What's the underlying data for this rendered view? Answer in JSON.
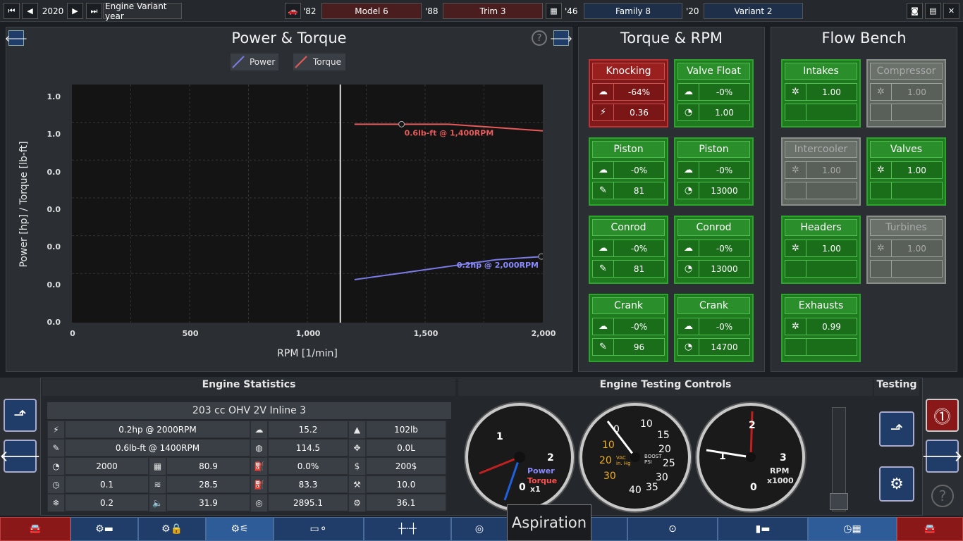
{
  "topbar": {
    "year_value": "2020",
    "year_label": "Engine Variant year",
    "model_year": "'82",
    "model": "Model 6",
    "trim_year": "'88",
    "trim": "Trim 3",
    "family_year": "'46",
    "family": "Family 8",
    "variant_year": "'20",
    "variant": "Variant 2"
  },
  "chart_panel": {
    "title": "Power & Torque",
    "legend_power": "Power",
    "legend_torque": "Torque"
  },
  "chart_data": {
    "type": "line",
    "xlabel": "RPM [1/min]",
    "ylabel": "Power [hp] / Torque [lb-ft]",
    "x_ticks": [
      "0",
      "500",
      "1,000",
      "1,500",
      "2,000"
    ],
    "y_ticks": [
      "1.0",
      "1.0",
      "0.0",
      "0.0",
      "0.0",
      "0.0",
      "0.0"
    ],
    "xlim": [
      0,
      2000
    ],
    "ylim": [
      0,
      0.72
    ],
    "cursor_rpm": 1140,
    "series": [
      {
        "name": "Power",
        "color": "#7b7be8",
        "x": [
          1200,
          1400,
          1600,
          1800,
          2000
        ],
        "y": [
          0.13,
          0.15,
          0.17,
          0.19,
          0.2
        ]
      },
      {
        "name": "Torque",
        "color": "#e85a5a",
        "x": [
          1200,
          1400,
          1600,
          1800,
          2000
        ],
        "y": [
          0.6,
          0.6,
          0.6,
          0.59,
          0.58
        ]
      }
    ],
    "annotations": {
      "torque": "0.6lb-ft @ 1,400RPM",
      "power": "0.2hp @ 2,000RPM"
    },
    "grid": true
  },
  "torque_panel": {
    "title": "Torque & RPM"
  },
  "torque_tiles": [
    {
      "name": "Knocking",
      "state": "bad",
      "r1": "-64%",
      "r2": "0.36",
      "i1": "☁",
      "i2": "⚡"
    },
    {
      "name": "Valve Float",
      "state": "ok",
      "r1": "-0%",
      "r2": "1.00",
      "i1": "☁",
      "i2": "◔"
    },
    {
      "name": "Piston",
      "state": "ok",
      "r1": "-0%",
      "r2": "81",
      "i1": "☁",
      "i2": "✎"
    },
    {
      "name": "Piston",
      "state": "ok",
      "r1": "-0%",
      "r2": "13000",
      "i1": "☁",
      "i2": "◔"
    },
    {
      "name": "Conrod",
      "state": "ok",
      "r1": "-0%",
      "r2": "81",
      "i1": "☁",
      "i2": "✎"
    },
    {
      "name": "Conrod",
      "state": "ok",
      "r1": "-0%",
      "r2": "13000",
      "i1": "☁",
      "i2": "◔"
    },
    {
      "name": "Crank",
      "state": "ok",
      "r1": "-0%",
      "r2": "96",
      "i1": "☁",
      "i2": "✎"
    },
    {
      "name": "Crank",
      "state": "ok",
      "r1": "-0%",
      "r2": "14700",
      "i1": "☁",
      "i2": "◔"
    }
  ],
  "flow_panel": {
    "title": "Flow Bench"
  },
  "flow_tiles": [
    {
      "name": "Intakes",
      "state": "ok",
      "v": "1.00"
    },
    {
      "name": "Compressor",
      "state": "off",
      "v": "1.00"
    },
    {
      "name": "Intercooler",
      "state": "off",
      "v": "1.00"
    },
    {
      "name": "Valves",
      "state": "ok",
      "v": "1.00"
    },
    {
      "name": "Headers",
      "state": "ok",
      "v": "1.00"
    },
    {
      "name": "Turbines",
      "state": "off",
      "v": "1.00"
    },
    {
      "name": "Exhausts",
      "state": "ok",
      "v": "0.99"
    }
  ],
  "stats": {
    "header": "Engine Statistics",
    "engine": "203 cc OHV 2V  Inline 3",
    "rows": [
      [
        "0.2hp @ 2000RPM",
        "15.2",
        "102lb"
      ],
      [
        "0.6lb-ft @ 1400RPM",
        "114.5",
        "0.0L"
      ],
      [
        "2000",
        "80.9",
        "0.0%",
        "200$"
      ],
      [
        "0.1",
        "28.5",
        "83.3",
        "10.0"
      ],
      [
        "0.2",
        "31.9",
        "2895.1",
        "36.1"
      ]
    ]
  },
  "testing_controls": {
    "header": "Engine Testing Controls",
    "testing": "Testing"
  },
  "gauges": {
    "power_label": "Power",
    "torque_label": "Torque",
    "mult": "x1",
    "vac_label": "VAC\nin. Hg",
    "boost_label": "BOOST\nPSI",
    "rpm_label": "RPM",
    "rpm_mult": "x1000"
  },
  "tooltip": "Aspiration",
  "colors": {
    "accent_blue": "#1f3d68",
    "ok_green": "#1f7a1f",
    "bad_red": "#801a1a",
    "power": "#7b7be8",
    "torque": "#e85a5a"
  }
}
